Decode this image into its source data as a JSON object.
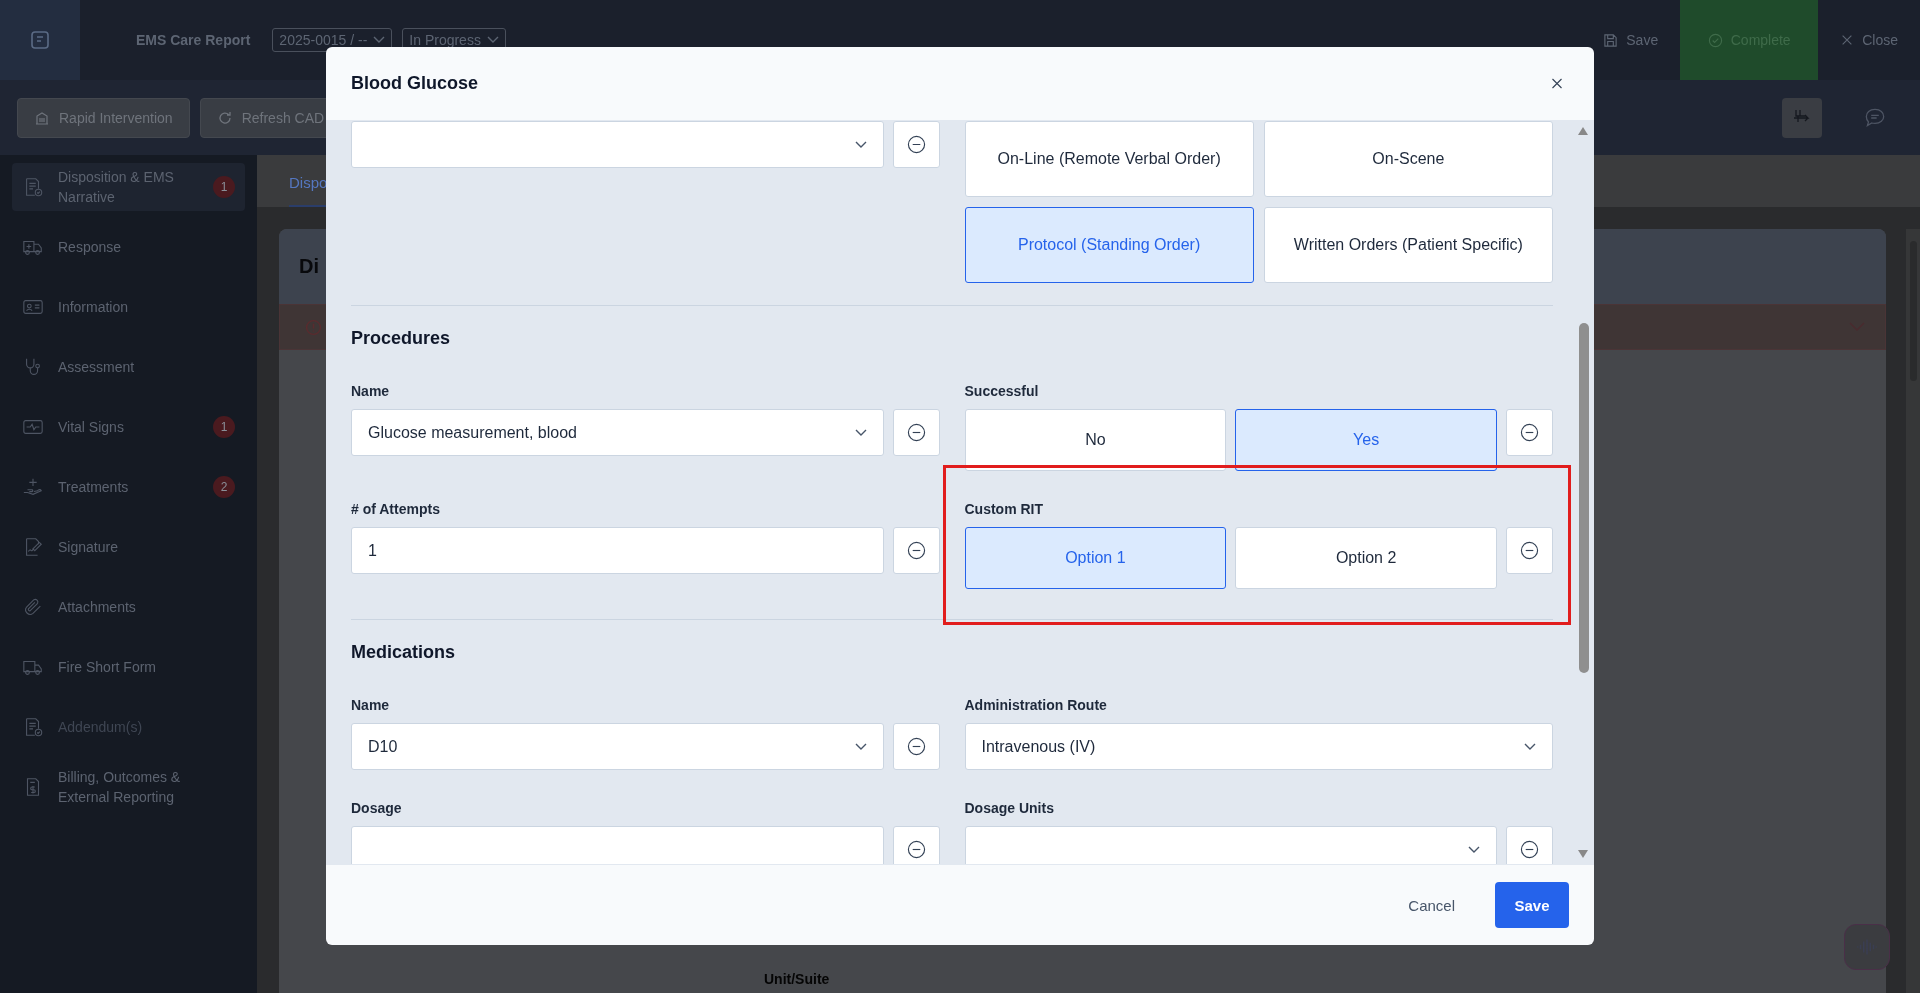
{
  "topbar": {
    "title": "EMS Care Report",
    "incident": "2025-0015 / --",
    "status": "In Progress",
    "actions": [
      {
        "label": "Save",
        "kind": "save"
      },
      {
        "label": "Complete",
        "kind": "complete"
      },
      {
        "label": "Close",
        "kind": "close"
      }
    ]
  },
  "toolbar": {
    "buttons": [
      {
        "label": "Rapid Intervention",
        "kind": "building"
      },
      {
        "label": "Refresh CAD",
        "kind": "refresh"
      }
    ]
  },
  "sidebar": {
    "items": [
      {
        "label": "Disposition & EMS Narrative",
        "badge": "1",
        "selected": true,
        "disabled": false
      },
      {
        "label": "Response",
        "selected": false,
        "disabled": false
      },
      {
        "label": "Information",
        "selected": false,
        "disabled": false
      },
      {
        "label": "Assessment",
        "selected": false,
        "disabled": false
      },
      {
        "label": "Vital Signs",
        "badge": "1",
        "selected": false,
        "disabled": false
      },
      {
        "label": "Treatments",
        "badge": "2",
        "selected": false,
        "disabled": false
      },
      {
        "label": "Signature",
        "selected": false,
        "disabled": false
      },
      {
        "label": "Attachments",
        "selected": false,
        "disabled": false
      },
      {
        "label": "Fire Short Form",
        "selected": false,
        "disabled": false
      },
      {
        "label": "Addendum(s)",
        "selected": false,
        "disabled": true
      },
      {
        "label": "Billing, Outcomes & External Reporting",
        "selected": false,
        "disabled": false
      }
    ]
  },
  "main": {
    "tab": "Dispo",
    "card_title": "Di",
    "field_label": "Unit/Suite"
  },
  "modal": {
    "title": "Blood Glucose",
    "top_options": [
      {
        "label": "On-Line (Remote Verbal Order)",
        "selected": false
      },
      {
        "label": "On-Scene",
        "selected": false
      },
      {
        "label": "Protocol (Standing Order)",
        "selected": true
      },
      {
        "label": "Written Orders (Patient Specific)",
        "selected": false
      }
    ],
    "sections": [
      {
        "heading": "Procedures",
        "rows": [
          {
            "left": {
              "label": "Name",
              "kind": "select",
              "value": "Glucose measurement, blood",
              "removable": true
            },
            "right": {
              "label": "Successful",
              "kind": "choice",
              "removable": true,
              "highlighted": false,
              "options": [
                {
                  "label": "No",
                  "selected": false
                },
                {
                  "label": "Yes",
                  "selected": true
                }
              ]
            }
          },
          {
            "left": {
              "label": "# of Attempts",
              "kind": "input",
              "value": "1",
              "removable": true
            },
            "right": {
              "label": "Custom RIT",
              "kind": "choice",
              "removable": true,
              "highlighted": true,
              "options": [
                {
                  "label": "Option 1",
                  "selected": true
                },
                {
                  "label": "Option 2",
                  "selected": false
                }
              ]
            }
          }
        ]
      },
      {
        "heading": "Medications",
        "rows": [
          {
            "left": {
              "label": "Name",
              "kind": "select",
              "value": "D10",
              "removable": true
            },
            "right": {
              "label": "Administration Route",
              "kind": "select",
              "value": "Intravenous (IV)",
              "removable": false
            }
          },
          {
            "left": {
              "label": "Dosage",
              "kind": "input",
              "removable": true
            },
            "right": {
              "label": "Dosage Units",
              "kind": "select",
              "removable": true
            }
          }
        ]
      }
    ],
    "cancel": "Cancel",
    "save": "Save"
  }
}
